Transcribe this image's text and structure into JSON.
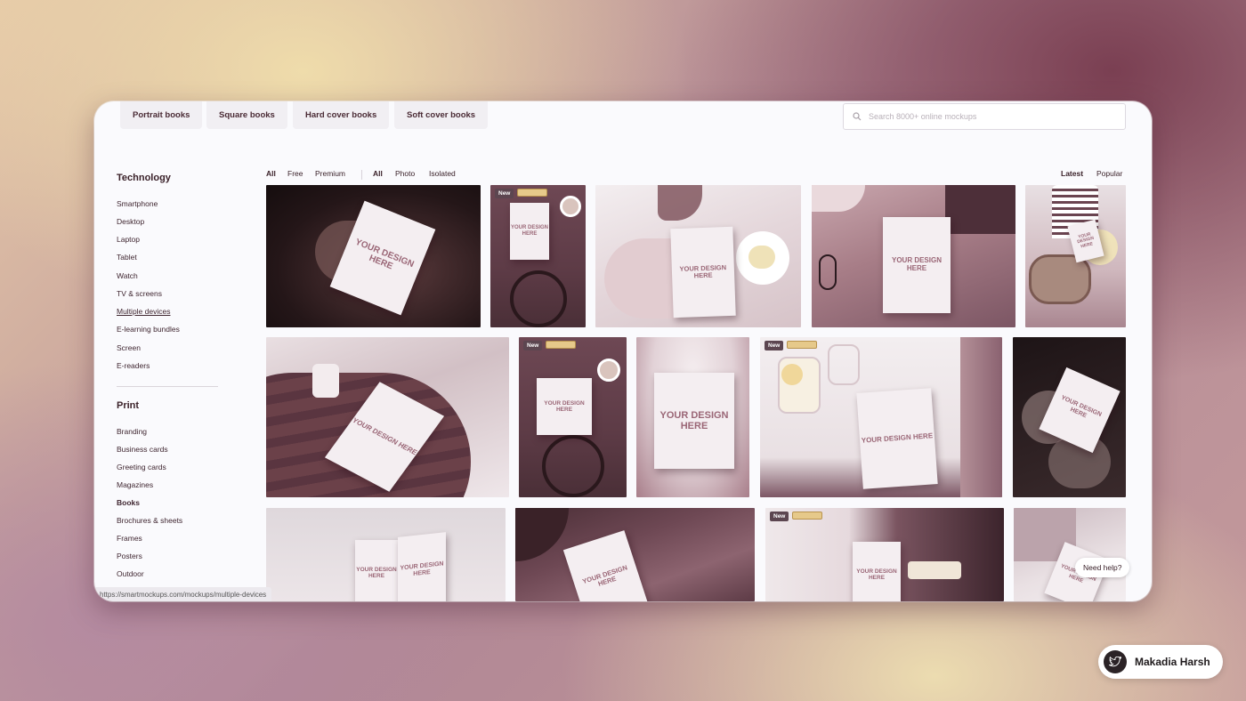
{
  "top_chips": [
    "Portrait books",
    "Square books",
    "Hard cover books",
    "Soft cover books"
  ],
  "search": {
    "placeholder": "Search 8000+ online mockups"
  },
  "sidebar": {
    "technology_heading": "Technology",
    "technology_items": [
      "Smartphone",
      "Desktop",
      "Laptop",
      "Tablet",
      "Watch",
      "TV & screens",
      "Multiple devices",
      "E-learning bundles",
      "Screen",
      "E-readers"
    ],
    "print_heading": "Print",
    "print_items": [
      "Branding",
      "Business cards",
      "Greeting cards",
      "Magazines",
      "Books",
      "Brochures & sheets",
      "Frames",
      "Posters",
      "Outdoor"
    ]
  },
  "filters": {
    "pricing": [
      "All",
      "Free",
      "Premium"
    ],
    "type": [
      "All",
      "Photo",
      "Isolated"
    ],
    "sort": [
      "Latest",
      "Popular"
    ]
  },
  "tiles": {
    "book_text": "YOUR DESIGN HERE",
    "new_label": "New"
  },
  "status_url": "https://smartmockups.com/mockups/multiple-devices",
  "help_label": "Need help?",
  "author": {
    "name": "Makadia Harsh",
    "icon": "twitter-bird-icon"
  },
  "colors": {
    "accent": "#3a2129",
    "background": "#fafafd"
  }
}
